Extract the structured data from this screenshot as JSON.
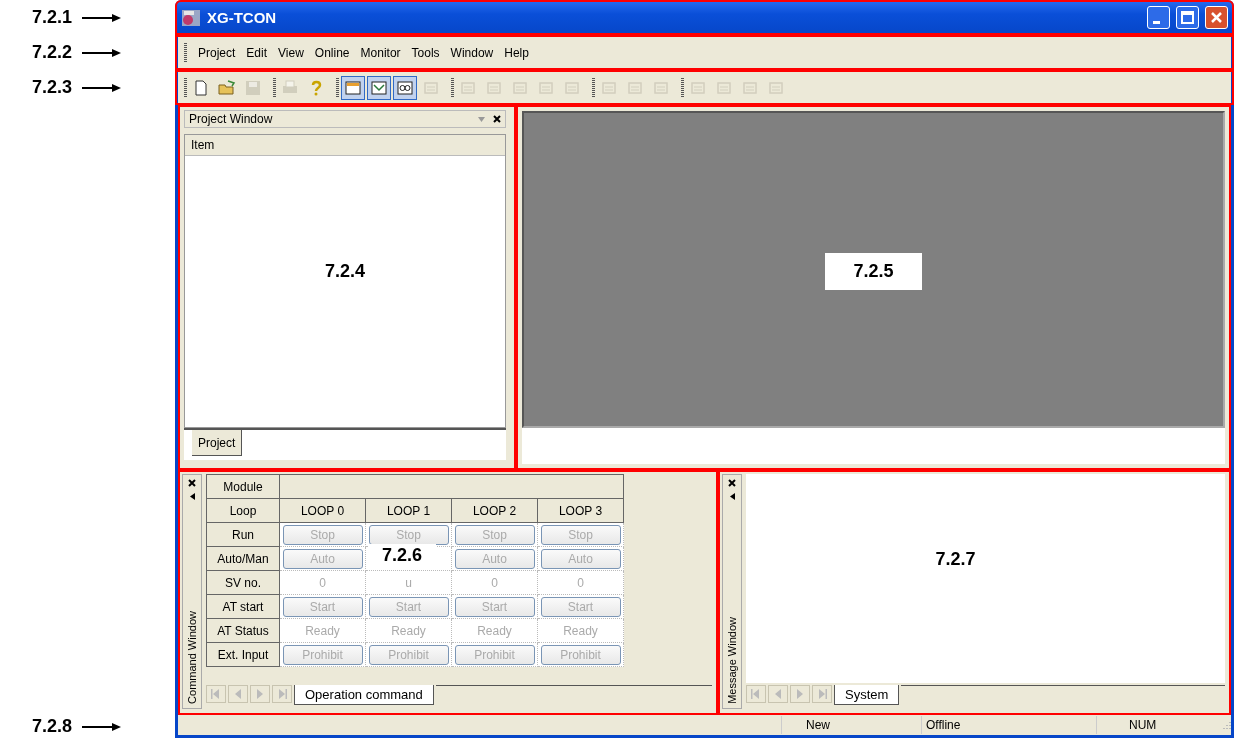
{
  "title_bar": {
    "callout": "7.2.1",
    "title": "XG-TCON"
  },
  "menu_bar": {
    "callout": "7.2.2",
    "items": [
      "Project",
      "Edit",
      "View",
      "Online",
      "Monitor",
      "Tools",
      "Window",
      "Help"
    ]
  },
  "toolbar": {
    "callout": "7.2.3",
    "groups": [
      [
        {
          "disabled": false,
          "pressed": false
        },
        {
          "disabled": false,
          "pressed": false
        },
        {
          "disabled": true,
          "pressed": false
        }
      ],
      [
        {
          "disabled": true,
          "pressed": false
        },
        {
          "disabled": false,
          "pressed": false
        }
      ],
      [
        {
          "disabled": false,
          "pressed": true
        },
        {
          "disabled": false,
          "pressed": true
        },
        {
          "disabled": false,
          "pressed": true
        },
        {
          "disabled": true,
          "pressed": false
        }
      ],
      [
        {
          "disabled": true,
          "pressed": false
        },
        {
          "disabled": true,
          "pressed": false
        },
        {
          "disabled": true,
          "pressed": false
        },
        {
          "disabled": true,
          "pressed": false
        },
        {
          "disabled": true,
          "pressed": false
        }
      ],
      [
        {
          "disabled": true,
          "pressed": false
        },
        {
          "disabled": true,
          "pressed": false
        },
        {
          "disabled": true,
          "pressed": false
        }
      ],
      [
        {
          "disabled": true,
          "pressed": false
        },
        {
          "disabled": true,
          "pressed": false
        },
        {
          "disabled": true,
          "pressed": false
        },
        {
          "disabled": true,
          "pressed": false
        }
      ]
    ]
  },
  "project_window": {
    "callout": "7.2.4",
    "title": "Project Window",
    "column": "Item",
    "tabs": [
      {
        "label": "Project",
        "selected": true
      }
    ]
  },
  "editor_area": {
    "callout": "7.2.5"
  },
  "command_window": {
    "callout": "7.2.6",
    "side_title": "Command Window",
    "module_label": "Module",
    "rows": [
      {
        "kind": "header",
        "label": "Loop",
        "cells": [
          "LOOP 0",
          "LOOP 1",
          "LOOP 2",
          "LOOP 3"
        ]
      },
      {
        "kind": "button",
        "label": "Run",
        "cells": [
          "Stop",
          "Stop",
          "Stop",
          "Stop"
        ]
      },
      {
        "kind": "button",
        "label": "Auto/Man",
        "cells": [
          "Auto",
          null,
          "Auto",
          "Auto"
        ]
      },
      {
        "kind": "value",
        "label": "SV no.",
        "cells": [
          "0",
          "u",
          "0",
          "0"
        ]
      },
      {
        "kind": "button",
        "label": "AT start",
        "cells": [
          "Start",
          "Start",
          "Start",
          "Start"
        ]
      },
      {
        "kind": "value",
        "label": "AT Status",
        "cells": [
          "Ready",
          "Ready",
          "Ready",
          "Ready"
        ]
      },
      {
        "kind": "button",
        "label": "Ext. Input",
        "cells": [
          "Prohibit",
          "Prohibit",
          "Prohibit",
          "Prohibit"
        ]
      }
    ],
    "tabs": [
      {
        "label": "Operation command",
        "selected": true
      }
    ]
  },
  "message_window": {
    "callout": "7.2.7",
    "side_title": "Message Window",
    "tabs": [
      {
        "label": "System",
        "selected": true
      }
    ]
  },
  "status_bar": {
    "callout": "7.2.8",
    "panes": [
      "New",
      "Offline",
      "NUM"
    ]
  }
}
